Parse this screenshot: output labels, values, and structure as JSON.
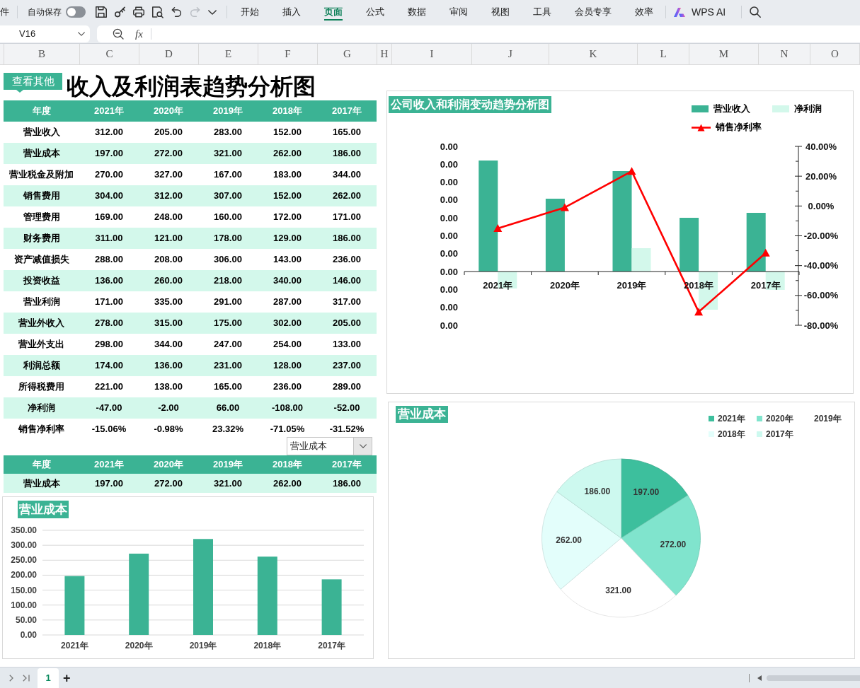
{
  "ribbon": {
    "menu_label": "件",
    "autosave": {
      "label": "自动保存",
      "on": false
    },
    "quick_access": [
      {
        "disabled": false
      },
      {
        "disabled": false
      },
      {
        "disabled": false
      },
      {
        "disabled": false
      },
      {
        "disabled": false
      },
      {
        "disabled": true
      },
      {
        "disabled": false
      }
    ],
    "tabs": [
      {
        "label": "开始",
        "selected": false
      },
      {
        "label": "插入",
        "selected": false
      },
      {
        "label": "页面",
        "selected": true
      },
      {
        "label": "公式",
        "selected": false
      },
      {
        "label": "数据",
        "selected": false
      },
      {
        "label": "审阅",
        "selected": false
      },
      {
        "label": "视图",
        "selected": false
      },
      {
        "label": "工具",
        "selected": false
      },
      {
        "label": "会员专享",
        "selected": false
      },
      {
        "label": "效率",
        "selected": false
      }
    ],
    "ai_button": "WPS AI"
  },
  "formula_bar": {
    "cell_ref": "V16",
    "function_label": "fx"
  },
  "column_headers": [
    "B",
    "C",
    "D",
    "E",
    "F",
    "G",
    "H",
    "I",
    "J",
    "K",
    "L",
    "M",
    "N",
    "O"
  ],
  "sheet": {
    "view_other_button": "查看其他",
    "title": "收入及利润表趋势分析图",
    "income_table": {
      "columns": [
        "年度",
        "2021年",
        "2020年",
        "2019年",
        "2018年",
        "2017年"
      ],
      "rows": [
        [
          "营业收入",
          "312.00",
          "205.00",
          "283.00",
          "152.00",
          "165.00"
        ],
        [
          "营业成本",
          "197.00",
          "272.00",
          "321.00",
          "262.00",
          "186.00"
        ],
        [
          "营业税金及附加",
          "270.00",
          "327.00",
          "167.00",
          "183.00",
          "344.00"
        ],
        [
          "销售费用",
          "304.00",
          "312.00",
          "307.00",
          "152.00",
          "262.00"
        ],
        [
          "管理费用",
          "169.00",
          "248.00",
          "160.00",
          "172.00",
          "171.00"
        ],
        [
          "财务费用",
          "311.00",
          "121.00",
          "178.00",
          "129.00",
          "186.00"
        ],
        [
          "资产减值损失",
          "288.00",
          "208.00",
          "306.00",
          "143.00",
          "236.00"
        ],
        [
          "投资收益",
          "136.00",
          "260.00",
          "218.00",
          "340.00",
          "146.00"
        ],
        [
          "营业利润",
          "171.00",
          "335.00",
          "291.00",
          "287.00",
          "317.00"
        ],
        [
          "营业外收入",
          "278.00",
          "315.00",
          "175.00",
          "302.00",
          "205.00"
        ],
        [
          "营业外支出",
          "298.00",
          "344.00",
          "247.00",
          "254.00",
          "133.00"
        ],
        [
          "利润总额",
          "174.00",
          "136.00",
          "231.00",
          "128.00",
          "237.00"
        ],
        [
          "所得税费用",
          "221.00",
          "138.00",
          "165.00",
          "236.00",
          "289.00"
        ],
        [
          "净利润",
          "-47.00",
          "-2.00",
          "66.00",
          "-108.00",
          "-52.00"
        ],
        [
          "销售净利率",
          "-15.06%",
          "-0.98%",
          "23.32%",
          "-71.05%",
          "-31.52%"
        ]
      ]
    },
    "selector": {
      "value": "营业成本"
    },
    "cost_table": {
      "columns": [
        "年度",
        "2021年",
        "2020年",
        "2019年",
        "2018年",
        "2017年"
      ],
      "rows": [
        [
          "营业成本",
          "197.00",
          "272.00",
          "321.00",
          "262.00",
          "186.00"
        ]
      ]
    },
    "cost_bar_chart": {
      "chart_data": {
        "type": "bar",
        "title": "营业成本",
        "categories": [
          "2021年",
          "2020年",
          "2019年",
          "2018年",
          "2017年"
        ],
        "series": [
          {
            "color": "#3bb394",
            "values": [
              197,
              272,
              321,
              262,
              186
            ]
          }
        ],
        "ylim": [
          0,
          350
        ],
        "yticks": [
          {
            "value": 350,
            "label": "350.00"
          },
          {
            "value": 300,
            "label": "300.00"
          },
          {
            "value": 250,
            "label": "250.00"
          },
          {
            "value": 200,
            "label": "200.00"
          },
          {
            "value": 150,
            "label": "150.00"
          },
          {
            "value": 100,
            "label": "100.00"
          },
          {
            "value": 50,
            "label": "50.00"
          },
          {
            "value": 0,
            "label": "0.00"
          }
        ],
        "grid": true
      }
    },
    "trend_chart": {
      "title": "公司收入和利润变动趋势分析图",
      "legend": [
        {
          "label": "营业收入",
          "kind": "bar",
          "color": "#3bb394"
        },
        {
          "label": "净利润",
          "kind": "bar",
          "color": "#d3f8eb"
        },
        {
          "label": "销售净利率",
          "kind": "line",
          "color": "#ff0000"
        }
      ],
      "left_axis_labels": [
        "0.00",
        "0.00",
        "0.00",
        "0.00",
        "0.00",
        "0.00",
        "0.00",
        "0.00",
        "0.00",
        "0.00",
        "0.00"
      ],
      "chart_data": {
        "type": "line",
        "categories": [
          "2021年",
          "2020年",
          "2019年",
          "2018年",
          "2017年"
        ],
        "series": [
          {
            "color": "#ff0000",
            "marker": "triangle",
            "values": [
              -15.06,
              -0.98,
              23.32,
              -71.05,
              -31.52
            ]
          }
        ],
        "ylim": [
          -80,
          40
        ],
        "yticks": [
          {
            "value": 40,
            "label": "40.00%"
          },
          {
            "value": 20,
            "label": "20.00%"
          },
          {
            "value": 0,
            "label": "0.00%"
          },
          {
            "value": -20,
            "label": "-20.00%"
          },
          {
            "value": -40,
            "label": "-40.00%"
          },
          {
            "value": -60,
            "label": "-60.00%"
          },
          {
            "value": -80,
            "label": "-80.00%"
          }
        ]
      }
    },
    "cost_pie_chart": {
      "chart_data": {
        "type": "pie",
        "title": "营业成本",
        "categories": [
          "2021年",
          "2020年",
          "2019年",
          "2018年",
          "2017年"
        ],
        "values": [
          197,
          272,
          321,
          262,
          186
        ],
        "colors": [
          "#3dbf9d",
          "#80e4cd",
          "#ffffff",
          "#e3fefb",
          "#cdf9ef"
        ],
        "value_labels": [
          "197.00",
          "272.00",
          "321.00",
          "262.00",
          "186.00"
        ]
      }
    }
  },
  "sheet_tabs": {
    "tabs": [
      {
        "label": "1",
        "selected": true
      }
    ],
    "add_label": "+"
  }
}
